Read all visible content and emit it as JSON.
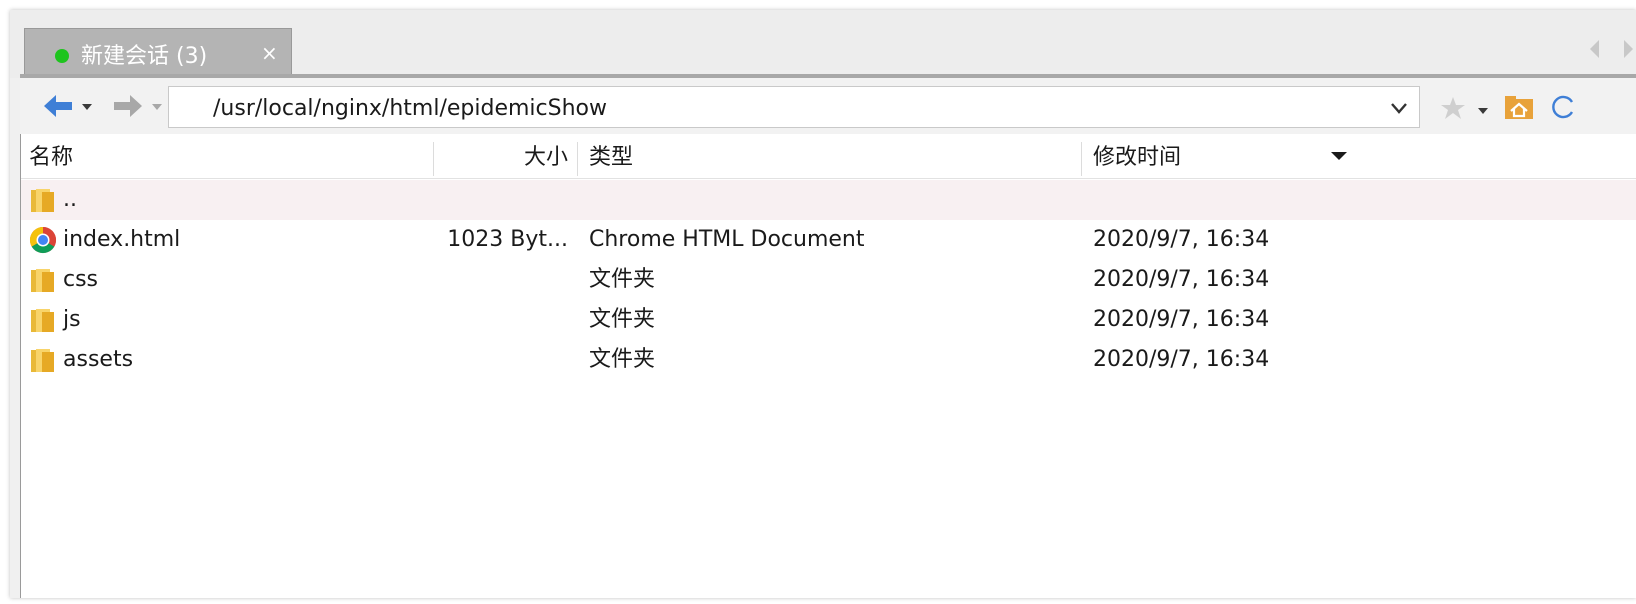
{
  "tab": {
    "label": "新建会话 (3)",
    "close": "×",
    "status_color": "#1ec41e"
  },
  "toolbar": {
    "back_icon": "arrow-left-icon",
    "forward_icon": "arrow-right-icon",
    "path": "/usr/local/nginx/html/epidemicShow",
    "favorite_icon": "star-icon",
    "home_icon": "home-folder-icon",
    "refresh_icon": "refresh-icon",
    "accent": "#3f7fd6"
  },
  "columns": {
    "name": "名称",
    "size": "大小",
    "type": "类型",
    "modified": "修改时间"
  },
  "rows": [
    {
      "icon": "folder-icon",
      "name": "..",
      "size": "",
      "type": "",
      "modified": ""
    },
    {
      "icon": "chrome-icon",
      "name": "index.html",
      "size": "1023 Byt...",
      "type": "Chrome HTML Document",
      "modified": "2020/9/7, 16:34"
    },
    {
      "icon": "folder-icon",
      "name": "css",
      "size": "",
      "type": "文件夹",
      "modified": "2020/9/7, 16:34"
    },
    {
      "icon": "folder-icon",
      "name": "js",
      "size": "",
      "type": "文件夹",
      "modified": "2020/9/7, 16:34"
    },
    {
      "icon": "folder-icon",
      "name": "assets",
      "size": "",
      "type": "文件夹",
      "modified": "2020/9/7, 16:34"
    }
  ]
}
